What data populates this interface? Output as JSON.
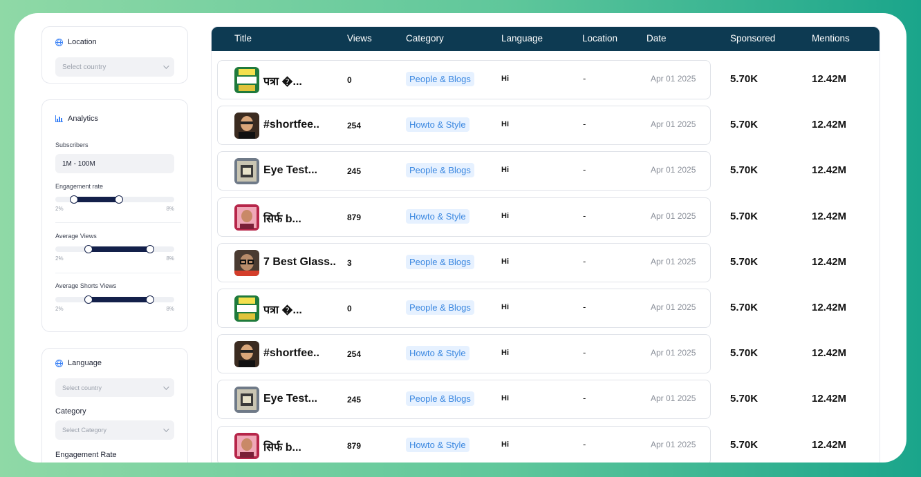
{
  "sidebar": {
    "location": {
      "title": "Location",
      "select_placeholder": "Select country"
    },
    "analytics": {
      "title": "Analytics",
      "subscribers_label": "Subscribers",
      "subscribers_value": "1M - 100M",
      "engagement_label": "Engagement rate",
      "engagement_min": "2%",
      "engagement_max": "8%",
      "avg_views_label": "Average Views",
      "avg_views_min": "2%",
      "avg_views_max": "8%",
      "avg_shorts_label": "Average Shorts Views",
      "avg_shorts_min": "2%",
      "avg_shorts_max": "8%"
    },
    "language": {
      "title": "Language",
      "select_placeholder": "Select country",
      "category_label": "Category",
      "category_placeholder": "Select Category",
      "engagement_label": "Engagement Rate"
    }
  },
  "table": {
    "columns": [
      "Title",
      "Views",
      "Category",
      "Language",
      "Location",
      "Date",
      "Sponsored",
      "Mentions"
    ],
    "rows": [
      {
        "title": "पत्रा �...",
        "views": "0",
        "category": "People & Blogs",
        "language": "Hi",
        "location": "-",
        "date": "Apr 01 2025",
        "sponsored": "5.70K",
        "mentions": "12.42M",
        "thumb": "green"
      },
      {
        "title": "#shortfee..",
        "views": "254",
        "category": "Howto & Style",
        "language": "Hi",
        "location": "-",
        "date": "Apr 01 2025",
        "sponsored": "5.70K",
        "mentions": "12.42M",
        "thumb": "portrait"
      },
      {
        "title": "Eye Test...",
        "views": "245",
        "category": "People & Blogs",
        "language": "Hi",
        "location": "-",
        "date": "Apr 01 2025",
        "sponsored": "5.70K",
        "mentions": "12.42M",
        "thumb": "test"
      },
      {
        "title": "सिर्फ b...",
        "views": "879",
        "category": "Howto & Style",
        "language": "Hi",
        "location": "-",
        "date": "Apr 01 2025",
        "sponsored": "5.70K",
        "mentions": "12.42M",
        "thumb": "pink"
      },
      {
        "title": "7 Best Glass..",
        "views": "3",
        "category": "People & Blogs",
        "language": "Hi",
        "location": "-",
        "date": "Apr 01 2025",
        "sponsored": "5.70K",
        "mentions": "12.42M",
        "thumb": "glasses"
      },
      {
        "title": "पत्रा �...",
        "views": "0",
        "category": "People & Blogs",
        "language": "Hi",
        "location": "-",
        "date": "Apr 01 2025",
        "sponsored": "5.70K",
        "mentions": "12.42M",
        "thumb": "green"
      },
      {
        "title": "#shortfee..",
        "views": "254",
        "category": "Howto & Style",
        "language": "Hi",
        "location": "-",
        "date": "Apr 01 2025",
        "sponsored": "5.70K",
        "mentions": "12.42M",
        "thumb": "portrait"
      },
      {
        "title": "Eye Test...",
        "views": "245",
        "category": "People & Blogs",
        "language": "Hi",
        "location": "-",
        "date": "Apr 01 2025",
        "sponsored": "5.70K",
        "mentions": "12.42M",
        "thumb": "test"
      },
      {
        "title": "सिर्फ b...",
        "views": "879",
        "category": "Howto & Style",
        "language": "Hi",
        "location": "-",
        "date": "Apr 01 2025",
        "sponsored": "5.70K",
        "mentions": "12.42M",
        "thumb": "pink"
      }
    ]
  },
  "colors": {
    "header_bg": "#0d3a52",
    "badge_bg": "#e6f1ff",
    "badge_text": "#3a87e0",
    "slider_fill": "#13204a",
    "accent": "#3b82f6"
  }
}
